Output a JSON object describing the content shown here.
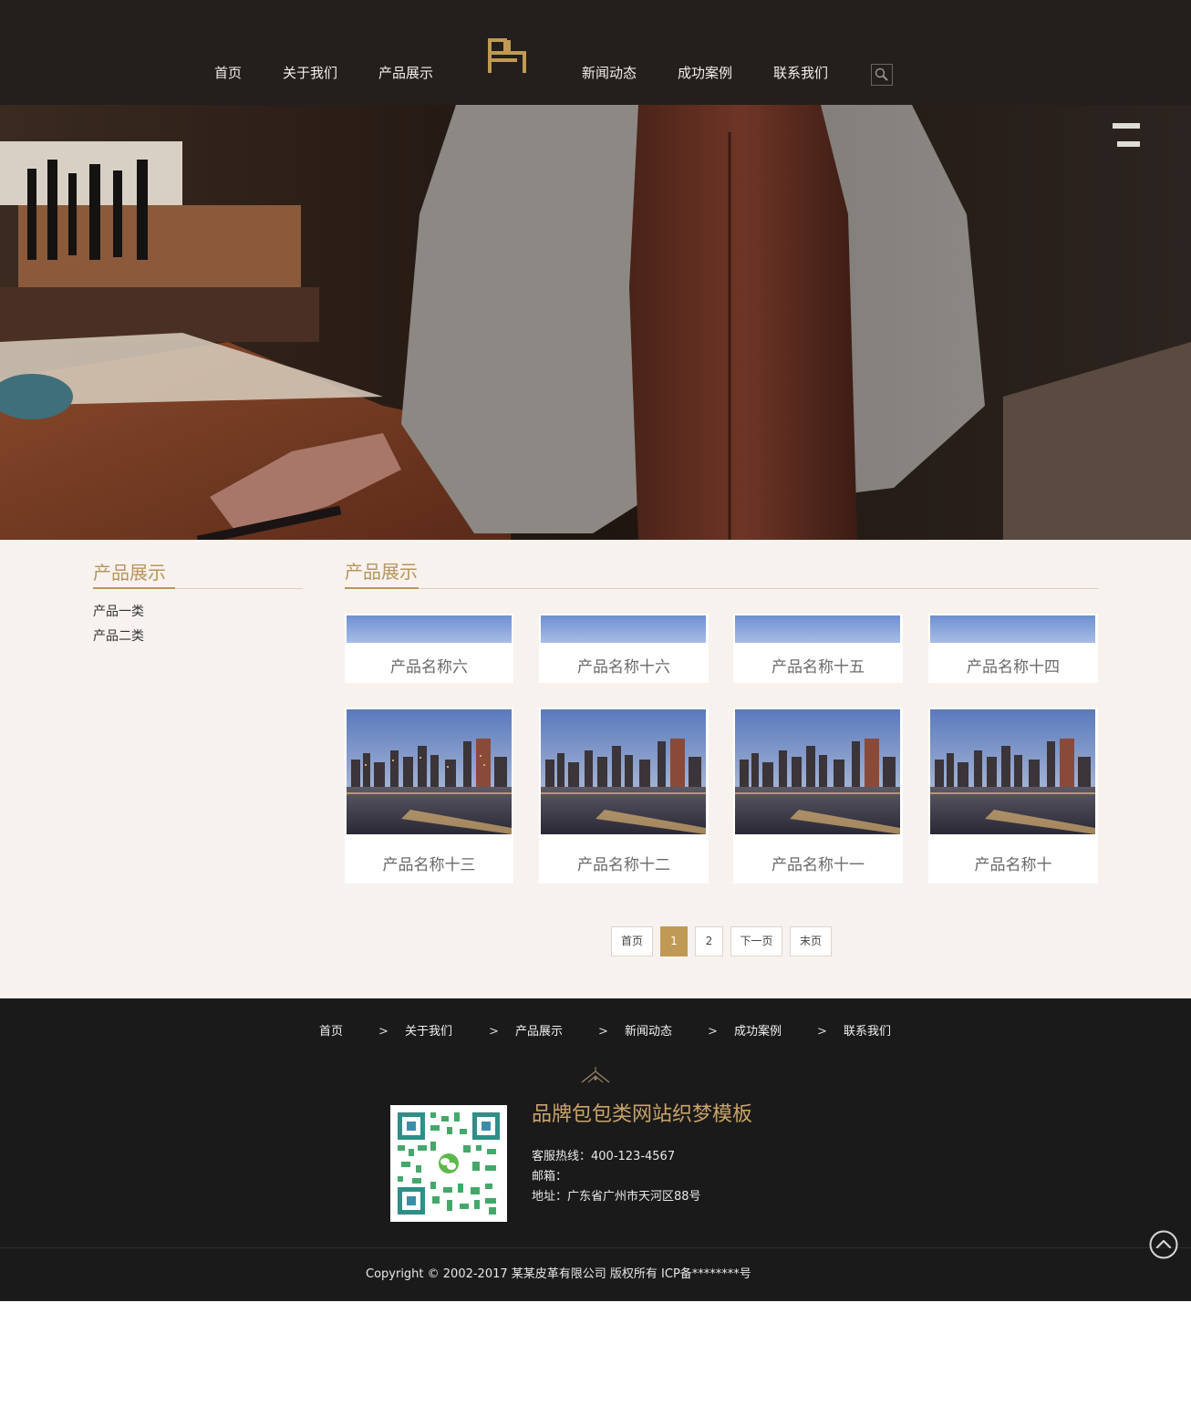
{
  "header": {
    "nav": [
      {
        "label": "首页"
      },
      {
        "label": "关于我们"
      },
      {
        "label": "产品展示"
      },
      {
        "label": "新闻动态"
      },
      {
        "label": "成功案例"
      },
      {
        "label": "联系我们"
      }
    ],
    "logo_icon": "bag-logo-icon",
    "search_icon": "search-icon"
  },
  "sidebar": {
    "title": "产品展示",
    "items": [
      {
        "label": "产品一类"
      },
      {
        "label": "产品二类"
      }
    ]
  },
  "content": {
    "title": "产品展示",
    "products": [
      {
        "name": "产品名称六",
        "image": "sky-strip"
      },
      {
        "name": "产品名称十六",
        "image": "sky-strip"
      },
      {
        "name": "产品名称十五",
        "image": "sky-strip"
      },
      {
        "name": "产品名称十四",
        "image": "sky-strip"
      },
      {
        "name": "产品名称十三",
        "image": "city-skyline"
      },
      {
        "name": "产品名称十二",
        "image": "city-skyline"
      },
      {
        "name": "产品名称十一",
        "image": "city-skyline"
      },
      {
        "name": "产品名称十",
        "image": "city-skyline"
      }
    ]
  },
  "pagination": {
    "first": "首页",
    "pages": [
      "1",
      "2"
    ],
    "current": "1",
    "next": "下一页",
    "last": "末页"
  },
  "footer": {
    "nav": [
      {
        "label": "首页"
      },
      {
        "label": "关于我们"
      },
      {
        "label": "产品展示"
      },
      {
        "label": "新闻动态"
      },
      {
        "label": "成功案例"
      },
      {
        "label": "联系我们"
      }
    ],
    "separator": ">",
    "brand_title": "品牌包包类网站织梦模板",
    "hotline": "客服热线：400-123-4567",
    "email": "邮箱：",
    "address": "地址：广东省广州市天河区88号",
    "copyright": "Copyright © 2002-2017 某某皮革有限公司 版权所有 ICP备********号",
    "qr_icon": "wechat-qr-code",
    "backtop_icon": "back-to-top-icon"
  },
  "colors": {
    "header_bg": "#231f1c",
    "accent_gold": "#b8955c",
    "main_bg": "#f7f2ee",
    "footer_bg": "#1b1a1a"
  }
}
